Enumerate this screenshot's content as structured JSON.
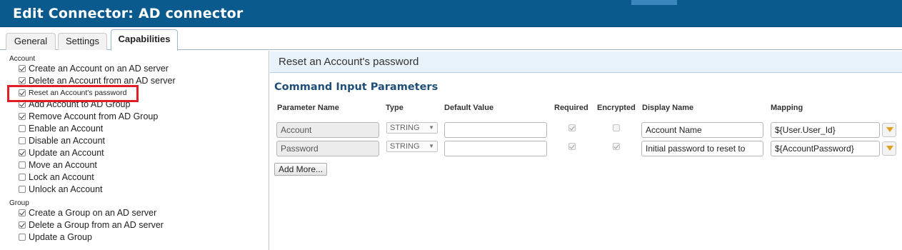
{
  "window": {
    "title": "Edit Connector: AD connector"
  },
  "tabs": [
    {
      "label": "General"
    },
    {
      "label": "Settings"
    },
    {
      "label": "Capabilities"
    }
  ],
  "capabilities": {
    "account_label": "Account",
    "account_items": [
      {
        "label": "Create an Account on an AD server",
        "checked": true
      },
      {
        "label": "Delete an Account from an AD server",
        "checked": true
      },
      {
        "label": "Reset an Account's password",
        "checked": true
      },
      {
        "label": "Add Account to AD Group",
        "checked": true
      },
      {
        "label": "Remove Account from AD Group",
        "checked": true
      },
      {
        "label": "Enable an Account",
        "checked": false
      },
      {
        "label": "Disable an Account",
        "checked": false
      },
      {
        "label": "Update an Account",
        "checked": true
      },
      {
        "label": "Move an Account",
        "checked": false
      },
      {
        "label": "Lock an Account",
        "checked": false
      },
      {
        "label": "Unlock an Account",
        "checked": false
      }
    ],
    "group_label": "Group",
    "group_items": [
      {
        "label": "Create a Group on an AD server",
        "checked": true
      },
      {
        "label": "Delete a Group from an AD server",
        "checked": true
      },
      {
        "label": "Update a Group",
        "checked": false
      }
    ]
  },
  "detail": {
    "header": "Reset an Account's password",
    "section_title": "Command Input Parameters",
    "columns": {
      "parameter_name": "Parameter Name",
      "type": "Type",
      "default_value": "Default Value",
      "required": "Required",
      "encrypted": "Encrypted",
      "display_name": "Display Name",
      "mapping": "Mapping"
    },
    "rows": [
      {
        "parameter_name": "Account",
        "type": "STRING",
        "default_value": "",
        "required": true,
        "encrypted": false,
        "display_name": "Account Name",
        "mapping": "${User.User_Id}"
      },
      {
        "parameter_name": "Password",
        "type": "STRING",
        "default_value": "",
        "required": true,
        "encrypted": true,
        "display_name": "Initial password to reset to",
        "mapping": "${AccountPassword}"
      }
    ],
    "add_more_label": "Add More..."
  }
}
